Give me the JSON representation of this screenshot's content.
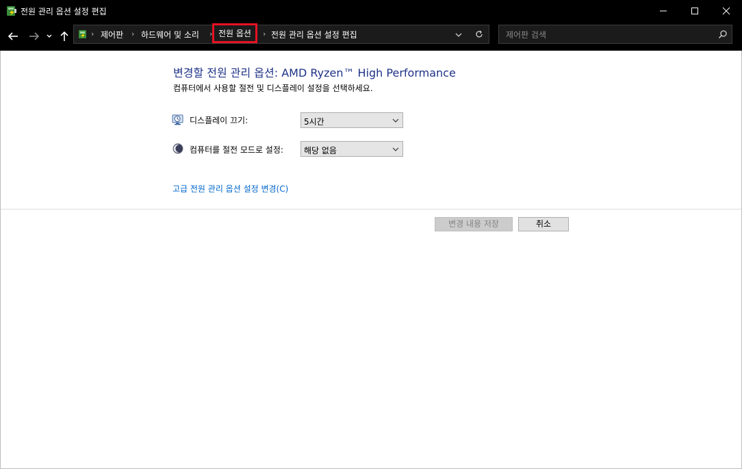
{
  "window": {
    "title": "전원 관리 옵션 설정 편집",
    "app_icon": "power-options-icon"
  },
  "address_bar": {
    "root_icon": "control-panel-icon",
    "breadcrumbs": [
      {
        "label": "제어판"
      },
      {
        "label": "하드웨어 및 소리"
      },
      {
        "label": "전원 옵션",
        "highlighted": true
      },
      {
        "label": "전원 관리 옵션 설정 편집"
      }
    ]
  },
  "search": {
    "placeholder": "제어판 검색"
  },
  "main": {
    "title": "변경할 전원 관리 옵션: AMD Ryzen™ High Performance",
    "subtitle": "컴퓨터에서 사용할 절전 및 디스플레이 설정을 선택하세요.",
    "settings": [
      {
        "label": "디스플레이 끄기:",
        "icon": "monitor-clock-icon",
        "value": "5시간"
      },
      {
        "label": "컴퓨터를 절전 모드로 설정:",
        "icon": "moon-icon",
        "value": "해당 없음"
      }
    ],
    "advanced_link": "고급 전원 관리 옵션 설정 변경(C)",
    "save_label": "변경 내용 저장",
    "cancel_label": "취소"
  },
  "colors": {
    "title_blue": "#1e3287",
    "link_blue": "#0066cc",
    "highlight_red": "#e81123"
  }
}
